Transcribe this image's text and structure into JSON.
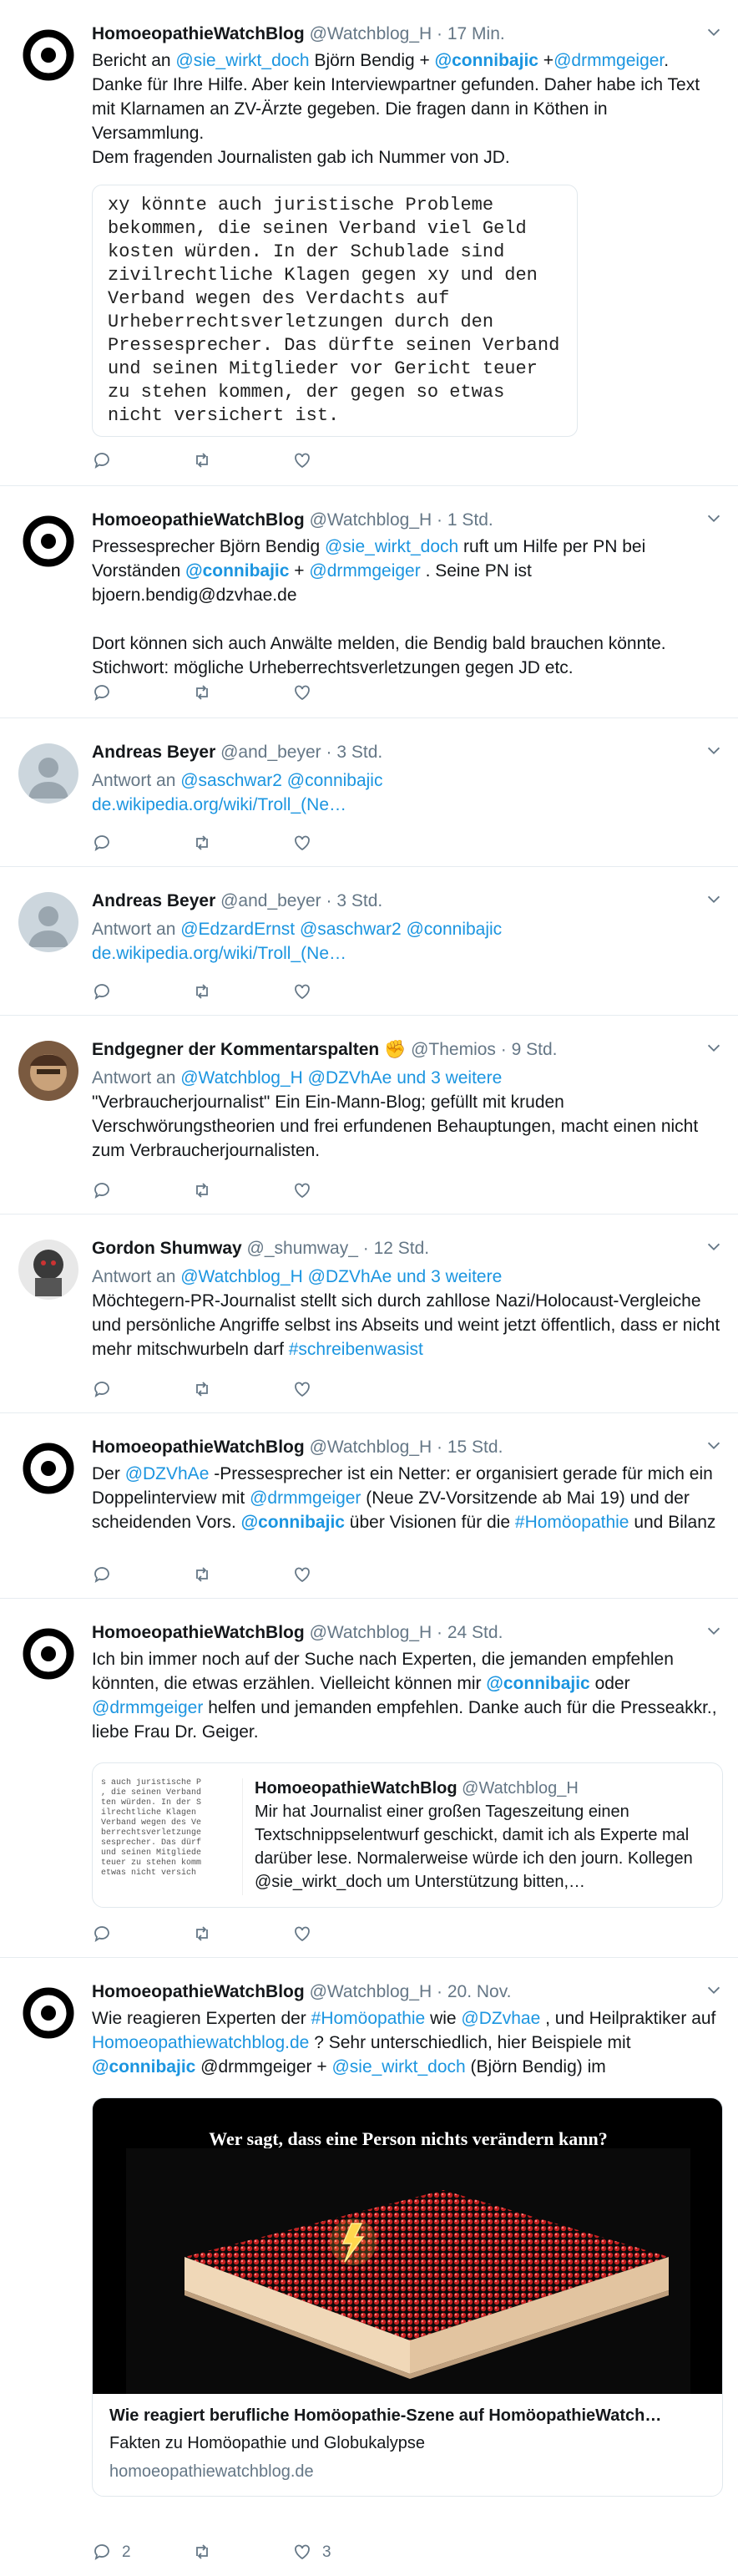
{
  "tweets": [
    {
      "name": "HomoeopathieWatchBlog",
      "handle": "@Watchblog_H",
      "time": "17 Min.",
      "text_parts": [
        "Bericht an ",
        "@sie_wirkt_doch",
        " Björn Bendig + ",
        "@connibajic",
        " +",
        "@drmmgeiger",
        "."
      ],
      "text2": "Danke für Ihre Hilfe. Aber kein Interviewpartner gefunden. Daher habe ich Text mit Klarnamen an ZV-Ärzte gegeben. Die fragen dann in Köthen in Versammlung.",
      "text3": "Dem fragenden Journalisten  gab ich Nummer von JD.",
      "image_text": "xy könnte auch juristische Probleme bekommen, die seinen Verband viel Geld kosten würden. In der Schublade sind zivilrechtliche Klagen gegen xy und den Verband wegen des Verdachts auf Urheberrechtsverletzungen durch den Pressesprecher. Das dürfte seinen Verband und seinen Mitglieder vor Gericht teuer zu stehen kommen, der gegen so etwas nicht versichert ist."
    },
    {
      "name": "HomoeopathieWatchBlog",
      "handle": "@Watchblog_H",
      "time": "1 Std.",
      "text_parts": [
        "Pressesprecher Björn Bendig ",
        "@sie_wirkt_doch",
        " ruft um Hilfe per PN bei Vorständen ",
        "@connibajic",
        " + ",
        "@drmmgeiger",
        " . Seine PN ist bjoern.bendig@dzvhae.de"
      ],
      "text2": "Dort können sich auch Anwälte melden, die Bendig bald brauchen könnte. Stichwort: mögliche Urheberrechtsverletzungen gegen JD etc."
    },
    {
      "name": "Andreas Beyer",
      "handle": "@and_beyer",
      "time": "3 Std.",
      "reply_label": "Antwort an",
      "reply_to": "@saschwar2 @connibajic",
      "link": "de.wikipedia.org/wiki/Troll_(Ne…"
    },
    {
      "name": "Andreas Beyer",
      "handle": "@and_beyer",
      "time": "3 Std.",
      "reply_label": "Antwort an",
      "reply_to": "@EdzardErnst @saschwar2 @connibajic",
      "link": "de.wikipedia.org/wiki/Troll_(Ne…"
    },
    {
      "name": "Endgegner der Kommentarspalten",
      "emoji": "✊",
      "handle": "@Themios",
      "time": "9 Std.",
      "reply_label": "Antwort an",
      "reply_to": "@Watchblog_H @DZVhAe",
      "reply_more": "und 3 weitere",
      "text": "\"Verbraucherjournalist\" Ein Ein-Mann-Blog; gefüllt mit kruden Verschwörungstheorien und frei erfundenen Behauptungen, macht einen nicht zum Verbraucherjournalisten."
    },
    {
      "name": "Gordon Shumway",
      "handle": "@_shumway_",
      "time": "12 Std.",
      "reply_label": "Antwort an",
      "reply_to": "@Watchblog_H @DZVhAe",
      "reply_more": "und 3 weitere",
      "text": "Möchtegern-PR-Journalist stellt sich durch zahllose Nazi/Holocaust-Vergleiche und persönliche Angriffe selbst ins Abseits und weint jetzt öffentlich, dass er nicht mehr mitschwurbeln darf ",
      "hashtag": "#schreibenwasist"
    },
    {
      "name": "HomoeopathieWatchBlog",
      "handle": "@Watchblog_H",
      "time": "15 Std.",
      "text_parts": [
        "Der ",
        "@DZVhAe",
        " -Pressesprecher ist ein Netter: er organisiert gerade für mich ein Doppelinterview mit ",
        "@drmmgeiger",
        " (Neue ZV-Vorsitzende ab Mai 19) und der scheidenden Vors. ",
        "@connibajic",
        " über Visionen für die ",
        "#Homöopathie",
        " und Bilanz"
      ]
    },
    {
      "name": "HomoeopathieWatchBlog",
      "handle": "@Watchblog_H",
      "time": "24 Std.",
      "text_parts": [
        "Ich bin immer noch auf der Suche nach Experten, die jemanden empfehlen könnten, die etwas erzählen. Vielleicht können mir ",
        "@connibajic",
        " oder ",
        "@drmmgeiger",
        " helfen und jemanden empfehlen. Danke auch für die Presseakkr., liebe Frau Dr. Geiger."
      ],
      "quote_name": "HomoeopathieWatchBlog",
      "quote_handle": "@Watchblog_H",
      "quote_text": "Mir hat Journalist einer großen Tageszeitung einen Textschnippselentwurf geschickt, damit ich als Experte mal darüber lese. Normalerweise würde ich den journ. Kollegen @sie_wirkt_doch um Unterstützung bitten,…",
      "quote_image_text": "s auch juristische P\n, die seinen Verband\nten würden. In der S\nilrechtliche Klagen \nVerband wegen des Ve\nberrechtsverletzunge\nsesprecher. Das dürf\nund seinen Mitgliede\nteuer zu stehen komm\netwas nicht versich"
    },
    {
      "name": "HomoeopathieWatchBlog",
      "handle": "@Watchblog_H",
      "time": "20. Nov.",
      "text_parts": [
        "Wie reagieren Experten der ",
        "#Homöopathie",
        " wie ",
        "@DZvhae",
        " , und Heilpraktiker auf  ",
        "Homoeopathiewatchblog.de",
        " ? Sehr unterschiedlich, hier Beispiele mit ",
        "@connibajic",
        " @drmmgeiger + ",
        "@sie_wirkt_doch",
        " (Björn Bendig)  im"
      ],
      "card_image_text": "Wer sagt, dass eine Person nichts verändern kann?",
      "card_title": "Wie reagiert berufliche Homöopathie-Szene auf HomöopathieWatch…",
      "card_desc": "Fakten zu Homöopathie und Globukalypse",
      "card_domain": "homoeopathiewatchblog.de",
      "reply_count": "2",
      "like_count": "3"
    }
  ],
  "colors": {
    "link": "#1b95e0",
    "muted": "#657786",
    "border": "#e6ecf0"
  }
}
